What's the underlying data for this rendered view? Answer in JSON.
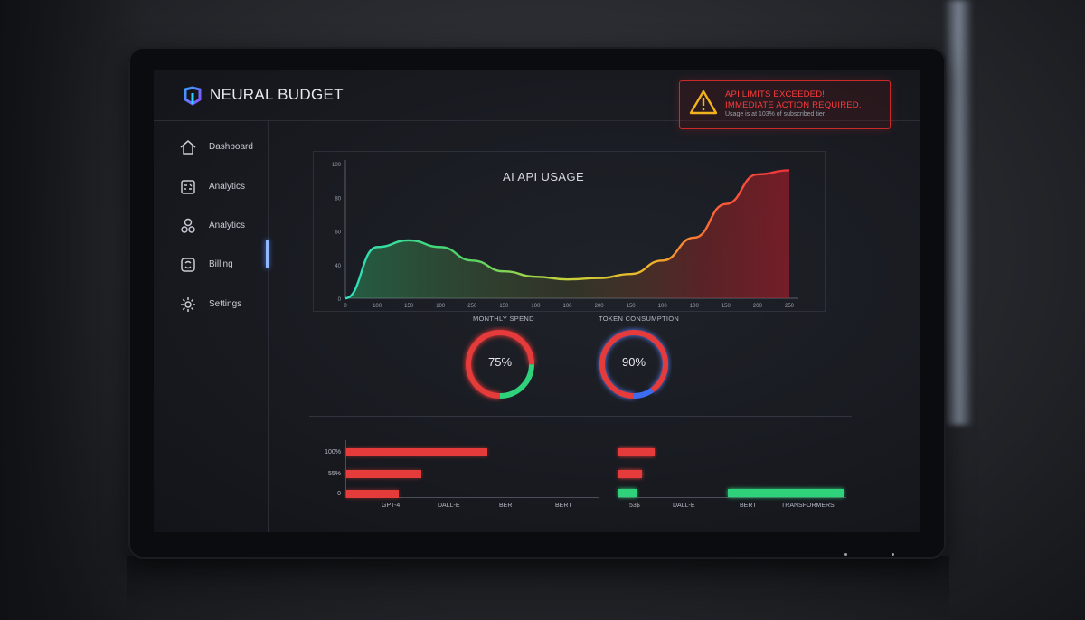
{
  "app": {
    "name": "NEURAL BUDGET"
  },
  "alert": {
    "line1": "API LIMITS EXCEEDED!",
    "line2": "IMMEDIATE ACTION REQUIRED.",
    "line3": "Usage is at 103% of subscribed tier"
  },
  "sidebar": {
    "items": [
      {
        "label": "Dashboard",
        "icon": "home-icon"
      },
      {
        "label": "Analytics",
        "icon": "chart-icon"
      },
      {
        "label": "Analytics",
        "icon": "users-icon"
      },
      {
        "label": "Billing",
        "icon": "billing-icon"
      },
      {
        "label": "Settings",
        "icon": "gear-icon"
      }
    ]
  },
  "colors": {
    "danger": "#e53b3b",
    "ok": "#2fd27a",
    "accent": "#3d6cf0",
    "warning": "#f0b429"
  },
  "chart_data": [
    {
      "type": "area",
      "title": "AI API USAGE",
      "y_tick_labels": [
        "100",
        "80",
        "60",
        "40",
        "0"
      ],
      "x_tick_labels": [
        "0",
        "100",
        "150",
        "100",
        "250",
        "150",
        "100",
        "100",
        "200",
        "150",
        "100",
        "100",
        "150",
        "200",
        "250"
      ],
      "series": [
        {
          "values": [
            0,
            38,
            43,
            38,
            28,
            20,
            16,
            14,
            15,
            18,
            28,
            45,
            70,
            92,
            95
          ]
        }
      ]
    },
    {
      "type": "pie",
      "title": "MONTHLY SPEND",
      "center_label": "75%",
      "values": [
        75,
        25
      ]
    },
    {
      "type": "pie",
      "title": "TOKEN CONSUMPTION",
      "center_label": "90%",
      "values": [
        90,
        10
      ]
    },
    {
      "type": "bar",
      "y_tick_labels": [
        "100%",
        "55%",
        "0"
      ],
      "categories": [
        "GPT-4",
        "DALL-E",
        "BERT",
        "BERT"
      ],
      "values": [
        100,
        53,
        37
      ]
    },
    {
      "type": "bar",
      "categories": [
        "53$",
        "DALL-E",
        "BERT",
        "TRANSFORMERS"
      ],
      "values": [
        20,
        13,
        10,
        64
      ]
    }
  ]
}
